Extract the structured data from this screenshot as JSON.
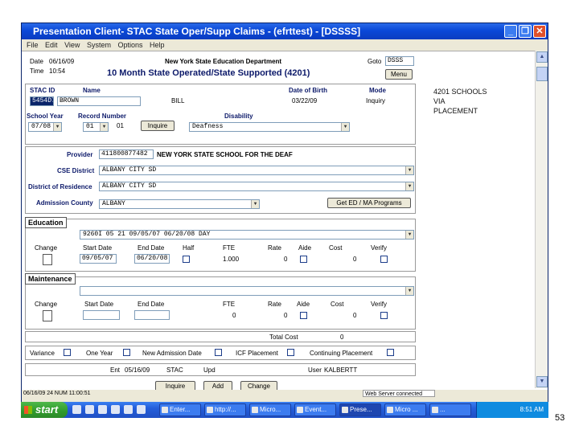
{
  "window": {
    "title": "Presentation Client- STAC State Oper/Supp Claims - (efrttest) - [DSSSS]",
    "menu": [
      "File",
      "Edit",
      "View",
      "System",
      "Options",
      "Help"
    ]
  },
  "header": {
    "date_label": "Date",
    "date_value": "06/16/09",
    "time_label": "Time",
    "time_value": "10:54",
    "dept": "New York State Education Department",
    "form_title": "10 Month State Operated/State Supported (4201)",
    "goto_label": "Goto",
    "goto_value": "DSSS",
    "menu_button": "Menu"
  },
  "student": {
    "stac_id_label": "STAC ID",
    "stac_id_value": "5454D7",
    "name_label": "Name",
    "name_value": "BROWN",
    "name_extra": "BILL",
    "dob_label": "Date of Birth",
    "dob_value": "03/22/09",
    "mode_label": "Mode",
    "mode_value": "Inquiry",
    "school_year_label": "School Year",
    "school_year_value": "07/08",
    "record_number_label": "Record Number",
    "record_number_value": "01",
    "record_suffix": "01",
    "inquire_button": "Inquire",
    "disability_label": "Disability",
    "disability_value": "Deafness"
  },
  "note": {
    "line1": "4201 SCHOOLS VIA",
    "line2": "PLACEMENT"
  },
  "provider": {
    "provider_label": "Provider",
    "provider_code": "411800877482",
    "provider_name": "NEW YORK STATE SCHOOL FOR THE DEAF",
    "cse_label": "CSE District",
    "cse_value": "ALBANY CITY SD",
    "dor_label": "District of Residence",
    "dor_value": "ALBANY CITY SD",
    "county_label": "Admission County",
    "county_value": "ALBANY",
    "get_programs_button": "Get ED / MA Programs"
  },
  "education": {
    "title": "Education",
    "program_value": "9260I                         05 21 09/05/07 06/20/08 DAY",
    "columns": [
      "Change",
      "Start Date",
      "End Date",
      "Half",
      "FTE",
      "Rate",
      "Aide",
      "Cost",
      "Verify"
    ],
    "start_date": "09/05/07",
    "end_date": "06/20/08",
    "fte": "1.000",
    "rate": "0",
    "cost": "0"
  },
  "maintenance": {
    "title": "Maintenance",
    "columns": [
      "Change",
      "Start Date",
      "End Date",
      "FTE",
      "Rate",
      "Aide",
      "Cost",
      "Verify"
    ],
    "fte": "0",
    "rate": "0",
    "cost": "0"
  },
  "total_cost": {
    "label": "Total Cost",
    "value": "0"
  },
  "flags": {
    "variance": "Variance",
    "one_year": "One Year",
    "new_admission": "New Admission Date",
    "icf_placement": "ICF Placement",
    "continuing_placement": "Continuing Placement"
  },
  "entry": {
    "ent_label": "Ent",
    "ent_value": "05/16/09",
    "ent_by": "STAC",
    "upd_label": "Upd",
    "user_label": "User",
    "user_value": "KALBERTT"
  },
  "bottom_buttons": [
    "Inquire",
    "Add",
    "Change"
  ],
  "status": {
    "left": "06/16/09 24  NUM  11:00:51",
    "right": "Web Server connected"
  },
  "taskbar": {
    "start": "start",
    "tasks": [
      "Enter...",
      "http://...",
      "Micro...",
      "Event...",
      "Prese...",
      "Micro ...",
      "..."
    ],
    "clock": "8:51 AM"
  },
  "page_number": "53",
  "colors": {
    "title_blue": "#0a48d8",
    "label_navy": "#0d1a6a",
    "taskbar_blue": "#245edb",
    "start_green": "#2f9a2c"
  }
}
